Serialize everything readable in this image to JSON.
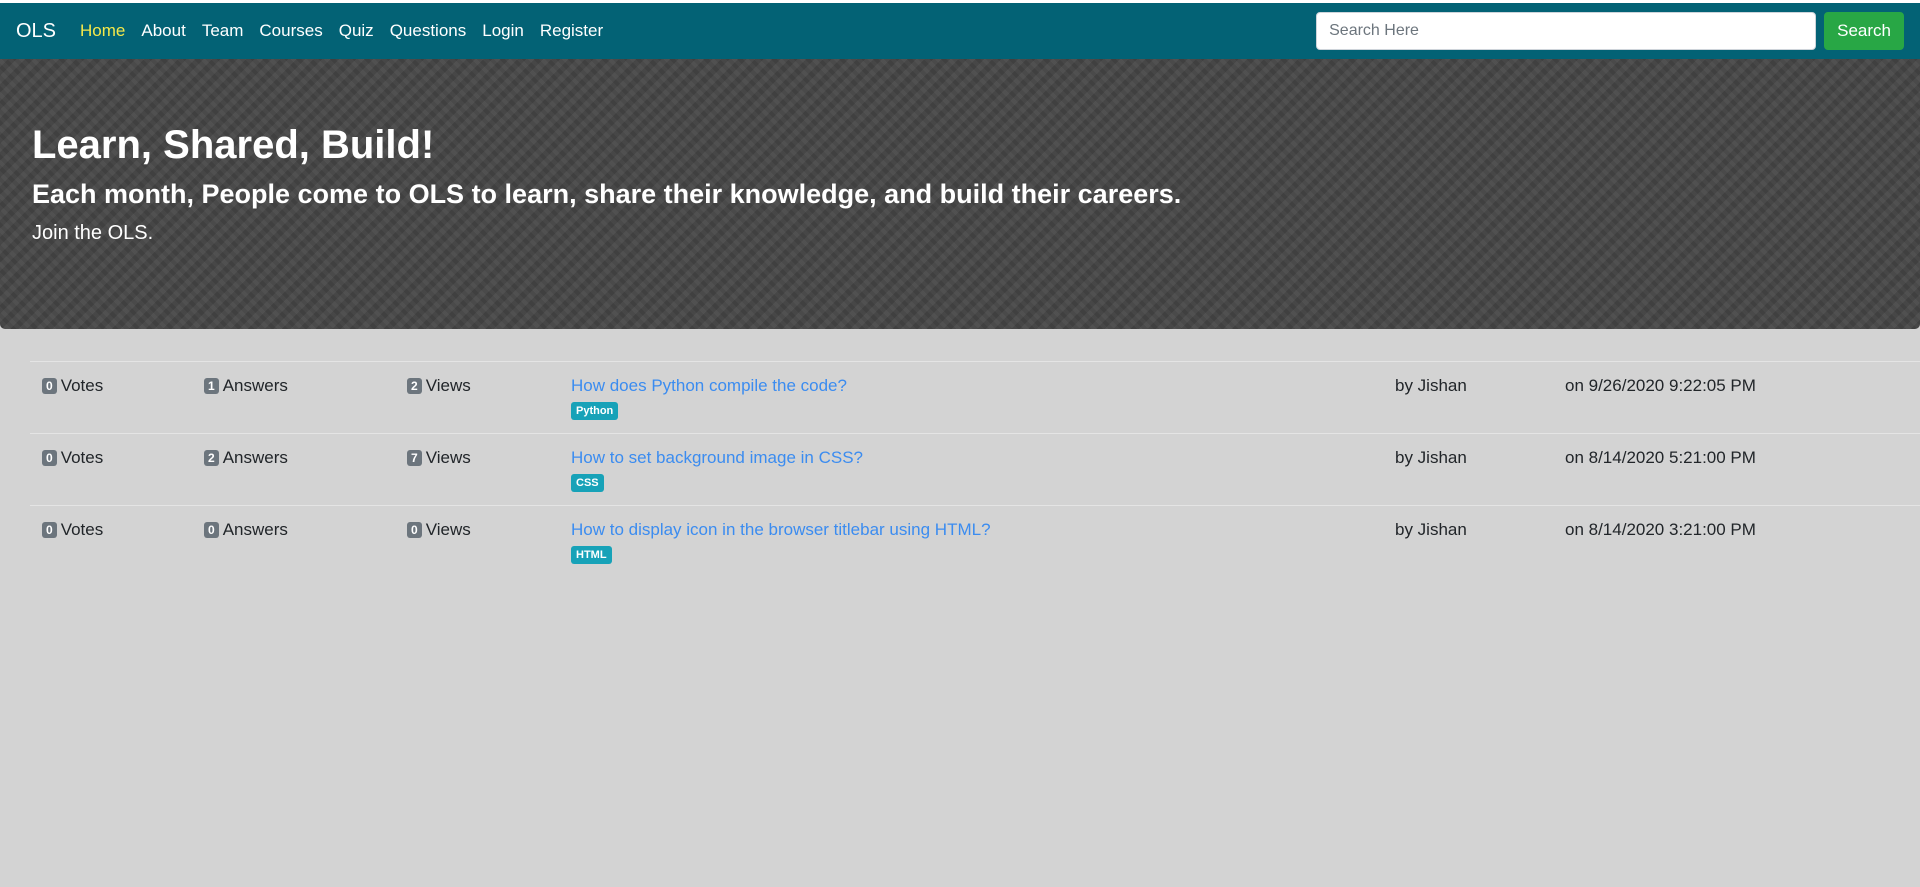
{
  "nav": {
    "brand": "OLS",
    "links": [
      {
        "label": "Home",
        "active": true
      },
      {
        "label": "About"
      },
      {
        "label": "Team"
      },
      {
        "label": "Courses"
      },
      {
        "label": "Quiz"
      },
      {
        "label": "Questions"
      },
      {
        "label": "Login"
      },
      {
        "label": "Register"
      }
    ],
    "search": {
      "placeholder": "Search Here",
      "value": "",
      "button_label": "Search"
    }
  },
  "hero": {
    "title": "Learn, Shared, Build!",
    "subtitle": "Each month, People come to OLS to learn, share their knowledge, and build their careers.",
    "tagline": "Join the OLS."
  },
  "questions": [
    {
      "votes": "0",
      "votes_label": "Votes",
      "answers": "1",
      "answers_label": "Answers",
      "views": "2",
      "views_label": "Views",
      "title": "How does Python compile the code?",
      "tag": "Python",
      "author": "by Jishan",
      "date": "on 9/26/2020 9:22:05 PM"
    },
    {
      "votes": "0",
      "votes_label": "Votes",
      "answers": "2",
      "answers_label": "Answers",
      "views": "7",
      "views_label": "Views",
      "title": "How to set background image in CSS?",
      "tag": "CSS",
      "author": "by Jishan",
      "date": "on 8/14/2020 5:21:00 PM"
    },
    {
      "votes": "0",
      "votes_label": "Votes",
      "answers": "0",
      "answers_label": "Answers",
      "views": "0",
      "views_label": "Views",
      "title": "How to display icon in the browser titlebar using HTML?",
      "tag": "HTML",
      "author": "by Jishan",
      "date": "on 8/14/2020 3:21:00 PM"
    }
  ],
  "colors": {
    "navbar": "#036275",
    "active_link": "#f5e84a",
    "search_button": "#28a745",
    "tag": "#17a2b8",
    "link": "#3b8cf0",
    "badge": "#6c757d"
  }
}
